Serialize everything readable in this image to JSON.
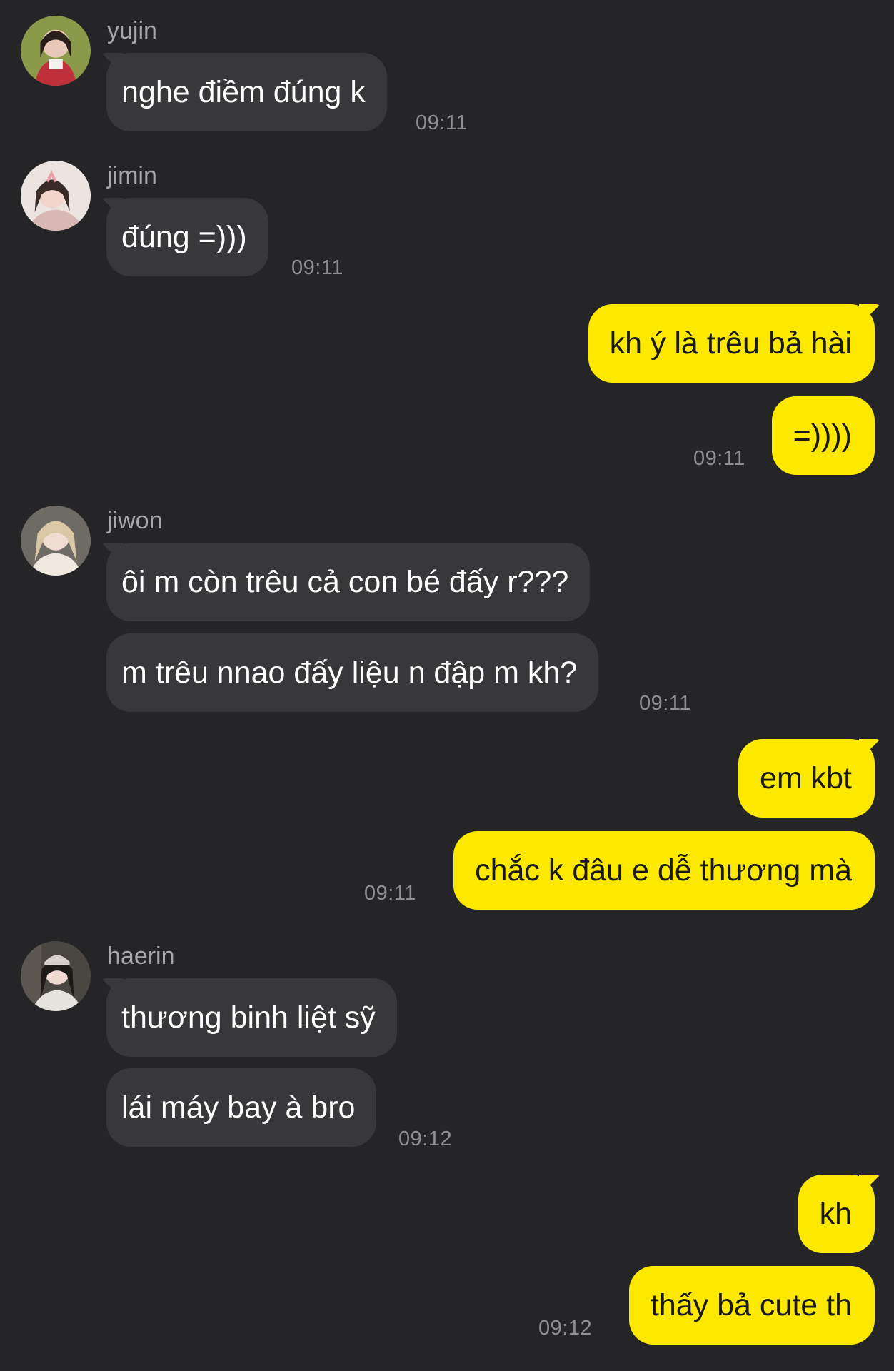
{
  "colors": {
    "background": "#252527",
    "incoming_bubble": "#38383b",
    "outgoing_bubble": "#fde900",
    "name_text": "#a8a8ab",
    "time_text": "#8f8f92"
  },
  "messages": [
    {
      "sender": "yujin",
      "avatar": "yujin-avatar-icon",
      "texts": [
        "nghe điềm đúng k"
      ],
      "time": "09:11"
    },
    {
      "sender": "jimin",
      "avatar": "jimin-avatar-icon",
      "texts": [
        "đúng =)))"
      ],
      "time": "09:11"
    },
    {
      "sender": "me",
      "texts": [
        "kh ý là trêu bả hài",
        "=))))"
      ],
      "time": "09:11"
    },
    {
      "sender": "jiwon",
      "avatar": "jiwon-avatar-icon",
      "texts": [
        "ôi m còn trêu cả con bé đấy r???",
        "m trêu nnao đấy liệu n đập m kh?"
      ],
      "time": "09:11"
    },
    {
      "sender": "me",
      "texts": [
        "em kbt",
        "chắc k đâu e dễ thương mà"
      ],
      "time": "09:11"
    },
    {
      "sender": "haerin",
      "avatar": "haerin-avatar-icon",
      "texts": [
        "thương binh liệt sỹ",
        "lái máy bay à bro"
      ],
      "time": "09:12"
    },
    {
      "sender": "me",
      "texts": [
        "kh",
        "thấy bả cute th"
      ],
      "time": "09:12"
    }
  ]
}
